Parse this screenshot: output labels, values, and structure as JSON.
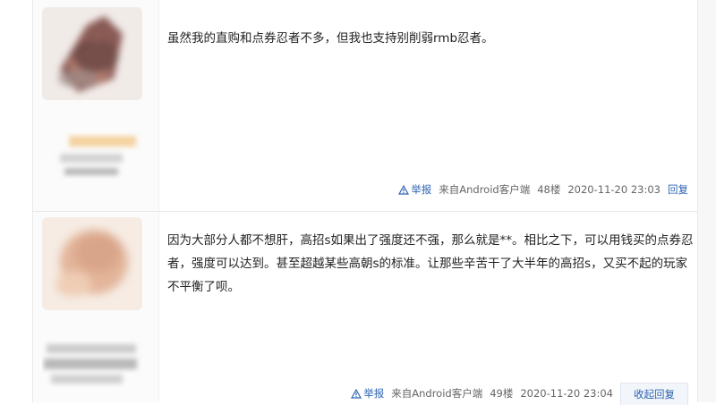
{
  "posts": [
    {
      "content": "虽然我的直购和点券忍者不多，但我也支持别削弱rmb忍者。",
      "report": "举报",
      "source": "来自Android客户端",
      "floor": "48楼",
      "time": "2020-11-20 23:03",
      "reply": "回复"
    },
    {
      "content": "因为大部分人都不想肝，高招s如果出了强度还不强，那么就是**。相比之下，可以用钱买的点券忍者，强度可以达到。甚至超越某些高朝s的标准。让那些辛苦干了大半年的高招s，又买不起的玩家不平衡了呗。",
      "report": "举报",
      "source": "来自Android客户端",
      "floor": "49楼",
      "time": "2020-11-20 23:04",
      "reply": "收起回复"
    }
  ],
  "icons": {
    "report": "warning-triangle-icon"
  },
  "colors": {
    "link": "#2d64b3",
    "text": "#222222",
    "meta": "#666666"
  }
}
